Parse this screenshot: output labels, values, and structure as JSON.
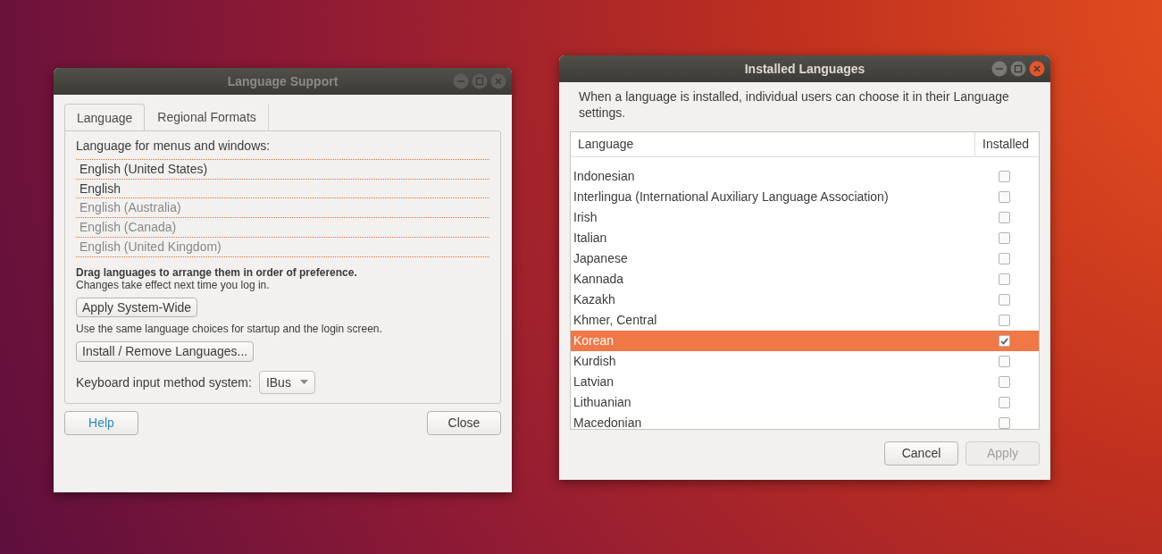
{
  "language_support": {
    "title": "Language Support",
    "active": false,
    "tabs": [
      {
        "label": "Language",
        "selected": true
      },
      {
        "label": "Regional Formats",
        "selected": false
      }
    ],
    "section_label": "Language for menus and windows:",
    "languages": [
      {
        "name": "English (United States)",
        "dimmed": false
      },
      {
        "name": "English",
        "dimmed": false
      },
      {
        "name": "English (Australia)",
        "dimmed": true
      },
      {
        "name": "English (Canada)",
        "dimmed": true
      },
      {
        "name": "English (United Kingdom)",
        "dimmed": true
      }
    ],
    "drag_hint": "Drag languages to arrange them in order of preference.",
    "login_hint": "Changes take effect next time you log in.",
    "apply_button": "Apply System-Wide",
    "apply_note": "Use the same language choices for startup and the login screen.",
    "install_button": "Install / Remove Languages...",
    "keyboard_label": "Keyboard input method system:",
    "keyboard_value": "IBus",
    "help_button": "Help",
    "close_button": "Close"
  },
  "installed_languages": {
    "title": "Installed Languages",
    "active": true,
    "description": "When a language is installed, individual users can choose it in their Language settings.",
    "columns": [
      "Language",
      "Installed"
    ],
    "rows": [
      {
        "name": "Indonesian",
        "checked": false,
        "selected": false
      },
      {
        "name": "Interlingua (International Auxiliary Language Association)",
        "checked": false,
        "selected": false
      },
      {
        "name": "Irish",
        "checked": false,
        "selected": false
      },
      {
        "name": "Italian",
        "checked": false,
        "selected": false
      },
      {
        "name": "Japanese",
        "checked": false,
        "selected": false
      },
      {
        "name": "Kannada",
        "checked": false,
        "selected": false
      },
      {
        "name": "Kazakh",
        "checked": false,
        "selected": false
      },
      {
        "name": "Khmer, Central",
        "checked": false,
        "selected": false
      },
      {
        "name": "Korean",
        "checked": true,
        "selected": true
      },
      {
        "name": "Kurdish",
        "checked": false,
        "selected": false
      },
      {
        "name": "Latvian",
        "checked": false,
        "selected": false
      },
      {
        "name": "Lithuanian",
        "checked": false,
        "selected": false
      },
      {
        "name": "Macedonian",
        "checked": false,
        "selected": false
      }
    ],
    "cancel_button": "Cancel",
    "apply_button": {
      "label": "Apply",
      "disabled": true
    }
  }
}
